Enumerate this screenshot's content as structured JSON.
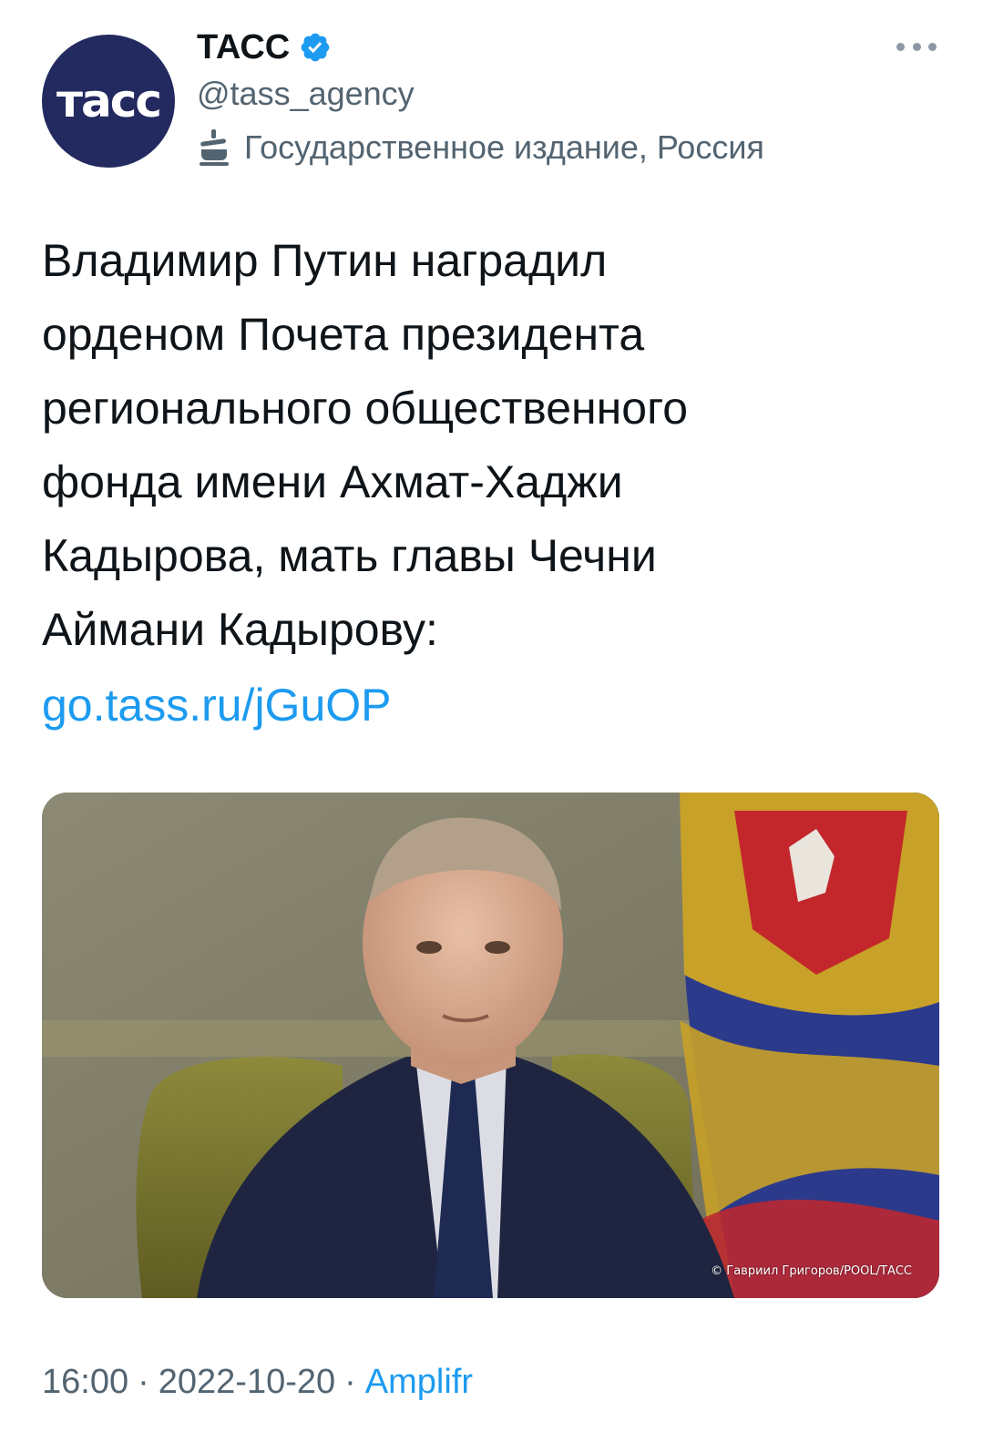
{
  "author": {
    "avatar_text": "тасс",
    "display_name": "ТАСС",
    "handle": "@tass_agency",
    "label": "Государственное издание, Россия",
    "verified_color": "#1d9bf0"
  },
  "tweet": {
    "text": "Владимир Путин наградил\nорденом Почета президента\nрегионального общественного\nфонда имени Ахмат-Хаджи\nКадырова, мать главы Чечни\nАймани Кадырову:",
    "link": "go.tass.ru/jGuOP",
    "photo_credit": "© Гавриил Григоров/POOL/ТАСС"
  },
  "meta": {
    "time": "16:00",
    "separator": "·",
    "date": "2022-10-20",
    "source": "Amplifr"
  },
  "colors": {
    "link": "#1d9bf0",
    "secondary_text": "#536471",
    "avatar_bg": "#232a5f"
  }
}
